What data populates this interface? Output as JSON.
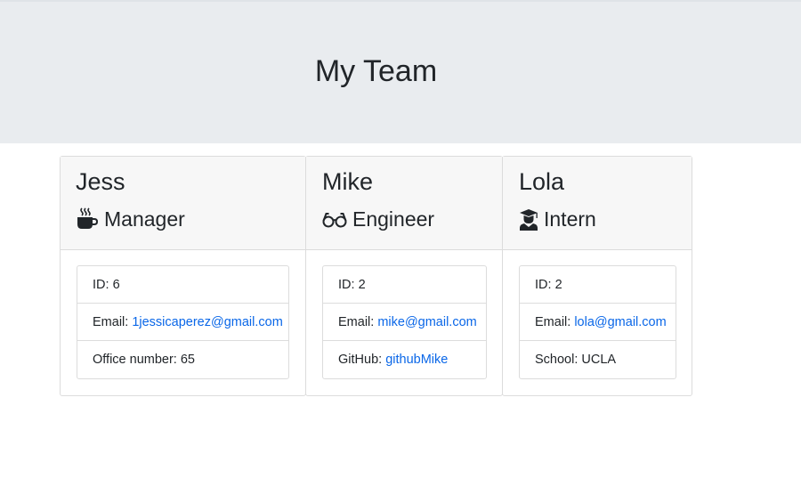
{
  "header": {
    "title": "My Team"
  },
  "employees": [
    {
      "name": "Jess",
      "role": "Manager",
      "icon": "coffee-icon",
      "id_label": "ID: ",
      "id": "6",
      "email_label": "Email: ",
      "email": "1jessicaperez@gmail.com",
      "extra_label": "Office number: ",
      "extra_value": "65"
    },
    {
      "name": "Mike",
      "role": "Engineer",
      "icon": "glasses-icon",
      "id_label": "ID: ",
      "id": "2",
      "email_label": "Email: ",
      "email": "mike@gmail.com",
      "extra_label": "GitHub: ",
      "extra_value": "githubMike"
    },
    {
      "name": "Lola",
      "role": "Intern",
      "icon": "graduate-icon",
      "id_label": "ID: ",
      "id": "2",
      "email_label": "Email: ",
      "email": "lola@gmail.com",
      "extra_label": "School: ",
      "extra_value": "UCLA"
    }
  ],
  "colors": {
    "header_bg": "#e9ecef",
    "card_header_bg": "#f7f7f7",
    "link": "#0a67e8",
    "text": "#212529"
  }
}
